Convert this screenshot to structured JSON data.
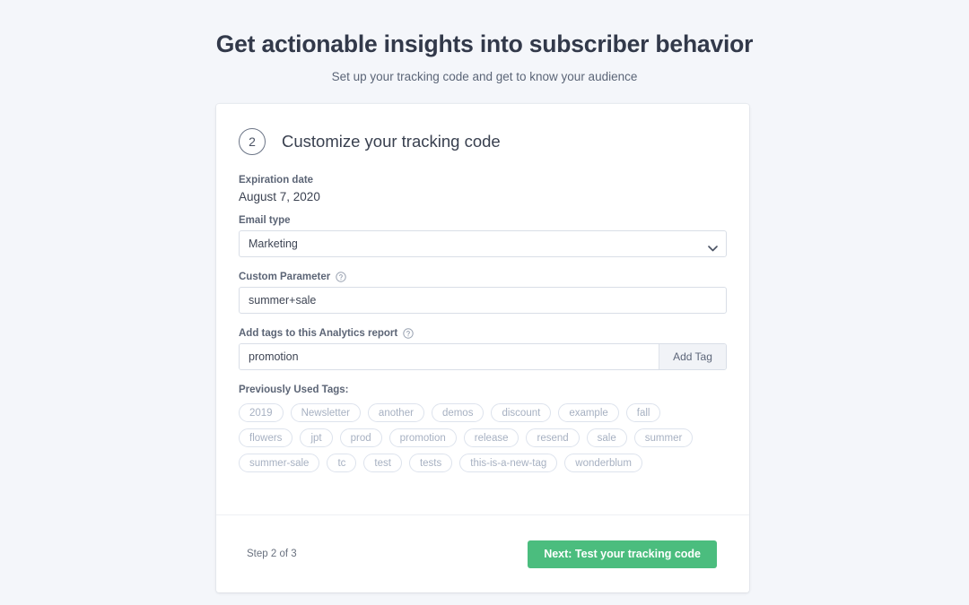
{
  "page": {
    "title": "Get actionable insights into subscriber behavior",
    "subtitle": "Set up your tracking code and get to know your audience",
    "background_color": "#f4f6fa"
  },
  "card": {
    "step_number": "2",
    "step_title": "Customize your tracking code",
    "expiration": {
      "label": "Expiration date",
      "value": "August 7, 2020"
    },
    "email_type": {
      "label": "Email type",
      "selected": "Marketing",
      "icon": "chevron-down-icon"
    },
    "custom_parameter": {
      "label": "Custom Parameter",
      "help_icon": "help-circle-icon",
      "value": "summer+sale"
    },
    "tags_field": {
      "label": "Add tags to this Analytics report",
      "help_icon": "help-circle-icon",
      "value": "promotion",
      "add_button_label": "Add Tag"
    },
    "previous_tags": {
      "label": "Previously Used Tags:",
      "items": [
        "2019",
        "Newsletter",
        "another",
        "demos",
        "discount",
        "example",
        "fall",
        "flowers",
        "jpt",
        "prod",
        "promotion",
        "release",
        "resend",
        "sale",
        "summer",
        "summer-sale",
        "tc",
        "test",
        "tests",
        "this-is-a-new-tag",
        "wonderblum"
      ]
    },
    "footer": {
      "step_counter": "Step 2 of 3",
      "next_label": "Next: Test your tracking code",
      "next_color": "#4bbd7e"
    }
  }
}
